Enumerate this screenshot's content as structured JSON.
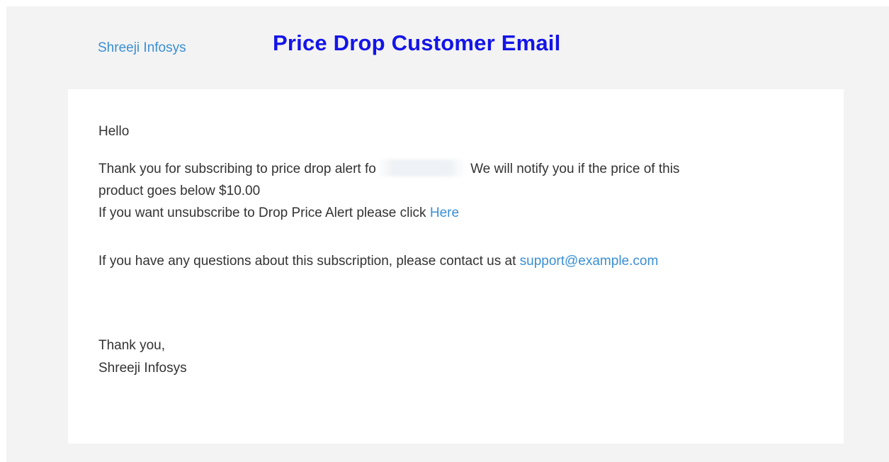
{
  "header": {
    "brand": "Shreeji Infosys",
    "title": "Price Drop Customer Email"
  },
  "email": {
    "greeting": "Hello",
    "line1_before": "Thank you for subscribing to price drop alert fo",
    "line1_after": " We will notify you if the price of this",
    "line2": "product goes below $10.00",
    "line3_text": "If you want unsubscribe to Drop Price Alert please click ",
    "line3_link": "Here",
    "questions_text": "If you have any questions about this subscription, please contact us at ",
    "questions_email": "support@example.com",
    "signoff": "Thank you,",
    "signature": "Shreeji Infosys"
  },
  "colors": {
    "title": "#1414e8",
    "link": "#3a8fd4",
    "background": "#f3f3f3",
    "card": "#ffffff"
  }
}
